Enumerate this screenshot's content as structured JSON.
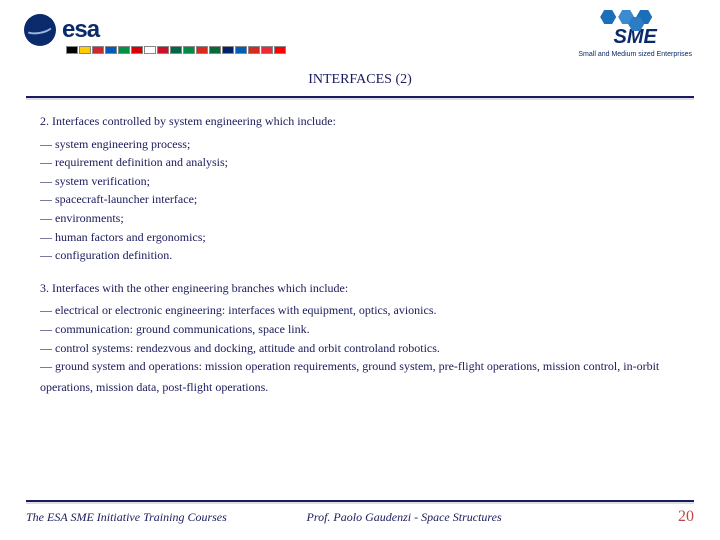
{
  "header": {
    "esa_text": "esa",
    "sme_text": "SME",
    "sme_subtitle": "Small and Medium sized Enterprises",
    "flag_colors": [
      "#000",
      "#ffcc00",
      "#cc2a2a",
      "#005bbb",
      "#009246",
      "#d00",
      "#fff",
      "#ce1126",
      "#006847",
      "#008c45",
      "#da291c",
      "#046a38",
      "#012169",
      "#005eb8",
      "#d52b1e",
      "#ed2939",
      "#ff0000"
    ]
  },
  "title": "INTERFACES (2)",
  "body": {
    "sec2_lead": "2. Interfaces controlled by system engineering which include:",
    "sec2_items": [
      "system engineering process;",
      "requirement definition and analysis;",
      "system verification;",
      "spacecraft-launcher interface;",
      "environments;",
      "human factors and ergonomics;",
      "configuration definition."
    ],
    "sec3_lead": "3. Interfaces with the other engineering branches which include:",
    "sec3_items": [
      "electrical or electronic engineering: interfaces with equipment, optics, avionics.",
      "communication: ground communications, space link.",
      "control systems: rendezvous and docking, attitude and orbit controland robotics.",
      "ground system and operations: mission operation requirements, ground system, pre-flight operations, mission control, in-orbit"
    ],
    "sec3_continuation": "operations, mission data, post-flight operations."
  },
  "footer": {
    "left": "The ESA SME Initiative Training Courses",
    "center": "Prof. Paolo Gaudenzi - Space Structures",
    "page": "20"
  }
}
